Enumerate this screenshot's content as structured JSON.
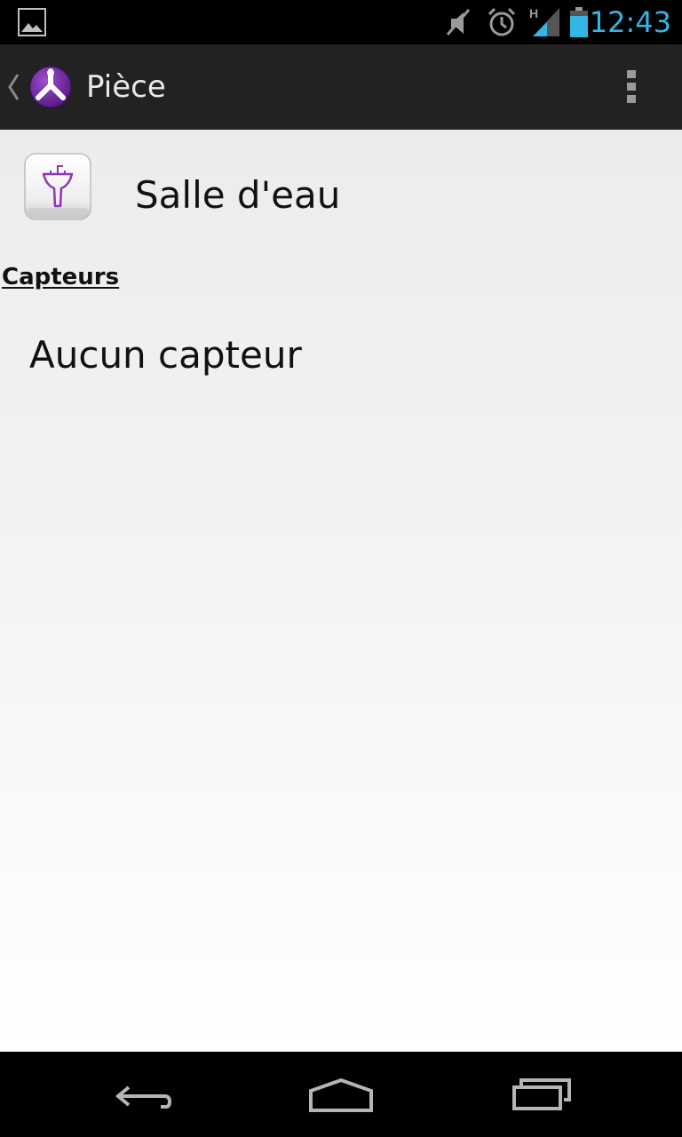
{
  "status_bar": {
    "time": "12:43",
    "time_color": "#33b5e5",
    "icons": [
      "gallery-notification-icon",
      "mute-icon",
      "alarm-icon",
      "hspa-signal-icon",
      "battery-icon"
    ]
  },
  "action_bar": {
    "title": "Pièce",
    "logo_icon": "app-logo-icon",
    "overflow_icon": "overflow-menu-icon",
    "accent_color": "#7b2fa8"
  },
  "room": {
    "name": "Salle d'eau",
    "icon": "washbasin-icon"
  },
  "sensors": {
    "section_title": "Capteurs",
    "empty_text": "Aucun capteur"
  },
  "nav_bar": {
    "buttons": [
      "back-icon",
      "home-icon",
      "recent-apps-icon"
    ]
  }
}
